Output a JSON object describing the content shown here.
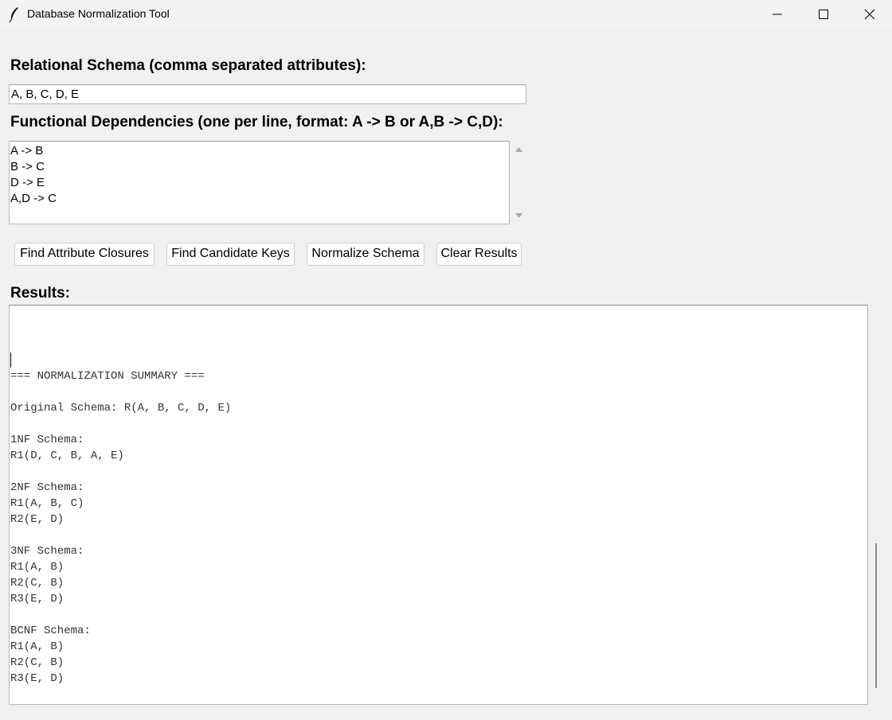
{
  "window": {
    "title": "Database Normalization Tool",
    "controls": [
      "minimize-icon",
      "maximize-icon",
      "close-icon"
    ]
  },
  "schema": {
    "label": "Relational Schema (comma separated attributes):",
    "value": "A, B, C, D, E"
  },
  "fds": {
    "label": "Functional Dependencies (one per line, format: A -> B or A,B -> C,D):",
    "lines": [
      "A -> B",
      "B -> C",
      "D -> E",
      "A,D -> C"
    ]
  },
  "buttons": {
    "closures": "Find Attribute Closures",
    "keys": "Find Candidate Keys",
    "normalize": "Normalize Schema",
    "clear": "Clear Results"
  },
  "results": {
    "label": "Results:",
    "lines": [
      "=== NORMALIZATION SUMMARY ===",
      "",
      "Original Schema: R(A, B, C, D, E)",
      "",
      "1NF Schema:",
      "R1(D, C, B, A, E)",
      "",
      "2NF Schema:",
      "R1(A, B, C)",
      "R2(E, D)",
      "",
      "3NF Schema:",
      "R1(A, B)",
      "R2(C, B)",
      "R3(E, D)",
      "",
      "BCNF Schema:",
      "R1(A, B)",
      "R2(C, B)",
      "R3(E, D)"
    ]
  }
}
